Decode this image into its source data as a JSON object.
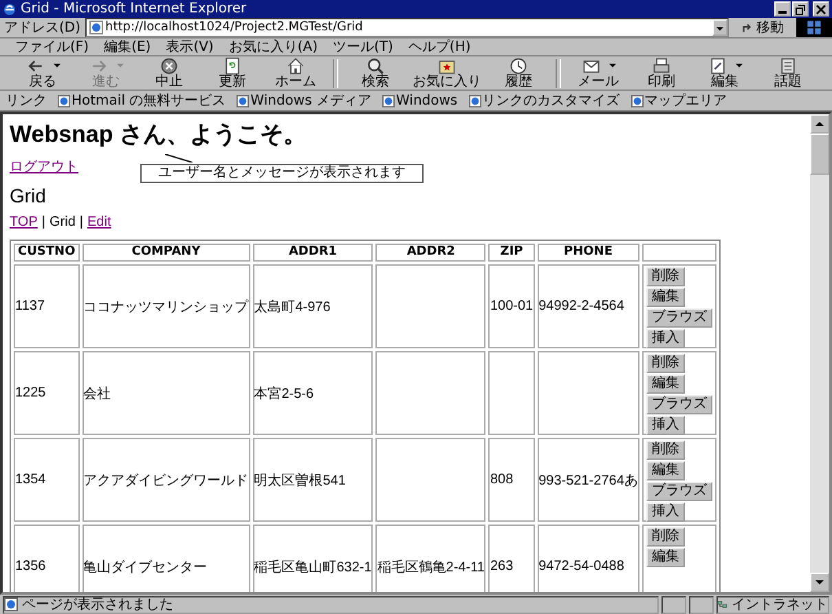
{
  "window": {
    "title": "Grid - Microsoft Internet Explorer"
  },
  "address_bar": {
    "label": "アドレス(D)",
    "url": "http://localhost1024/Project2.MGTest/Grid",
    "go_button": "移動"
  },
  "menu": [
    "ファイル(F)",
    "編集(E)",
    "表示(V)",
    "お気に入り(A)",
    "ツール(T)",
    "ヘルプ(H)"
  ],
  "toolbar_groups": [
    {
      "buttons": [
        {
          "label": "戻る",
          "kind": "back",
          "disabled": false,
          "dropdown": true
        },
        {
          "label": "進む",
          "kind": "forward",
          "disabled": true,
          "dropdown": true
        },
        {
          "label": "中止",
          "kind": "stop",
          "disabled": false,
          "dropdown": false
        },
        {
          "label": "更新",
          "kind": "refresh",
          "disabled": false,
          "dropdown": false
        },
        {
          "label": "ホーム",
          "kind": "home",
          "disabled": false,
          "dropdown": false
        }
      ]
    },
    {
      "buttons": [
        {
          "label": "検索",
          "kind": "search",
          "disabled": false,
          "dropdown": false
        },
        {
          "label": "お気に入り",
          "kind": "favorites",
          "disabled": false,
          "dropdown": false
        },
        {
          "label": "履歴",
          "kind": "history",
          "disabled": false,
          "dropdown": false
        }
      ]
    },
    {
      "buttons": [
        {
          "label": "メール",
          "kind": "mail",
          "disabled": false,
          "dropdown": true
        },
        {
          "label": "印刷",
          "kind": "print",
          "disabled": false,
          "dropdown": false
        },
        {
          "label": "編集",
          "kind": "edit",
          "disabled": false,
          "dropdown": true
        },
        {
          "label": "話題",
          "kind": "discuss",
          "disabled": false,
          "dropdown": false
        }
      ]
    }
  ],
  "links": {
    "label": "リンク",
    "items": [
      "Hotmail の無料サービス",
      "Windows メディア",
      "Windows",
      "リンクのカスタマイズ",
      "マップエリア"
    ]
  },
  "page": {
    "greeting": "Websnap さん、ようこそ。",
    "logout_link": "ログアウト",
    "callout": "ユーザー名とメッセージが表示されます",
    "heading": "Grid",
    "breadcrumb": [
      {
        "label": "TOP",
        "link": true
      },
      {
        "label": "Grid",
        "link": false
      },
      {
        "label": "Edit",
        "link": true
      }
    ],
    "breadcrumb_separator": "|",
    "table": {
      "columns": [
        "CUSTNO",
        "COMPANY",
        "ADDR1",
        "ADDR2",
        "ZIP",
        "PHONE"
      ],
      "rows": [
        {
          "cells": [
            "1137",
            "ココナッツマリンショップ",
            "太島町4-976",
            "",
            "100-01",
            "94992-2-4564"
          ],
          "actions": [
            "削除",
            "編集",
            "ブラウズ",
            "挿入"
          ]
        },
        {
          "cells": [
            "1225",
            "会社",
            "本宮2-5-6",
            "",
            "",
            ""
          ],
          "actions": [
            "削除",
            "編集",
            "ブラウズ",
            "挿入"
          ]
        },
        {
          "cells": [
            "1354",
            "アクアダイビングワールド",
            "明太区曽根541",
            "",
            "808",
            "993-521-2764あ"
          ],
          "actions": [
            "削除",
            "編集",
            "ブラウズ",
            "挿入"
          ]
        },
        {
          "cells": [
            "1356",
            "亀山ダイブセンター",
            "稲毛区亀山町632-1",
            "稲毛区鶴亀2-4-11",
            "263",
            "9472-54-0488"
          ],
          "actions": [
            "削除",
            "編集"
          ]
        }
      ]
    }
  },
  "status_bar": {
    "message": "ページが表示されました",
    "zone": "イントラネット"
  }
}
